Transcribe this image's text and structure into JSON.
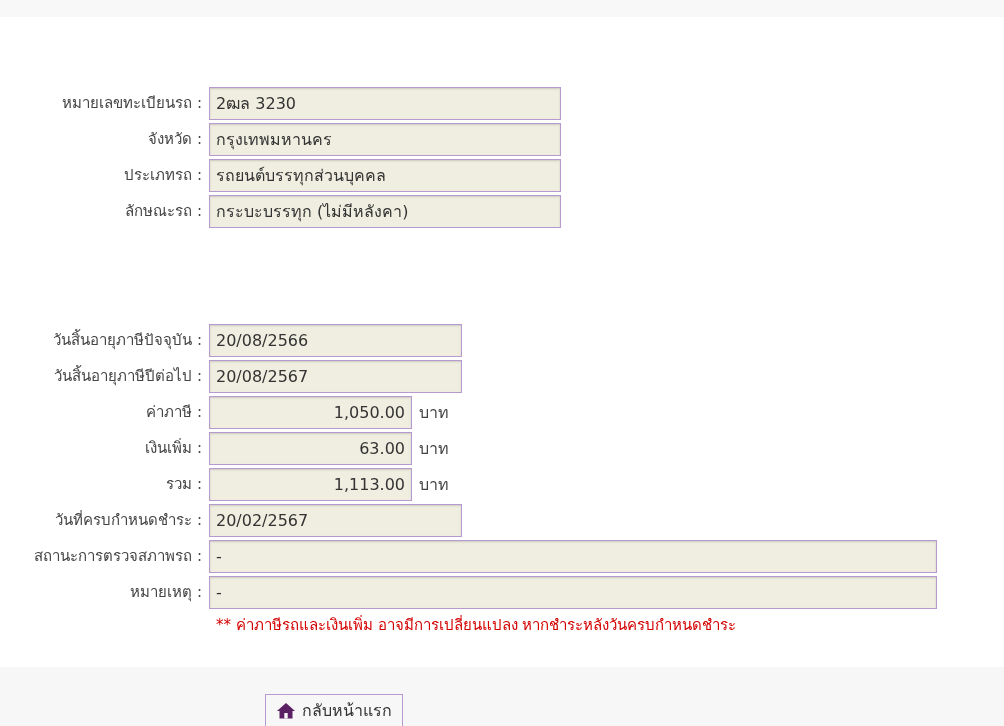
{
  "vehicle": [
    {
      "label": "หมายเลขทะเบียนรถ :",
      "value": "2ฒล 3230",
      "kind": "wide"
    },
    {
      "label": "จังหวัด :",
      "value": "กรุงเทพมหานคร",
      "kind": "wide"
    },
    {
      "label": "ประเภทรถ :",
      "value": "รถยนต์บรรทุกส่วนบุคคล",
      "kind": "wide"
    },
    {
      "label": "ลักษณะรถ :",
      "value": "กระบะบรรทุก (ไม่มีหลังคา)",
      "kind": "wide"
    }
  ],
  "tax": [
    {
      "label": "วันสิ้นอายุภาษีปัจจุบัน :",
      "value": "20/08/2566",
      "kind": "date"
    },
    {
      "label": "วันสิ้นอายุภาษีปีต่อไป :",
      "value": "20/08/2567",
      "kind": "date"
    },
    {
      "label": "ค่าภาษี :",
      "value": "1,050.00",
      "kind": "amount",
      "unit": "บาท"
    },
    {
      "label": "เงินเพิ่ม :",
      "value": "63.00",
      "kind": "amount",
      "unit": "บาท"
    },
    {
      "label": "รวม :",
      "value": "1,113.00",
      "kind": "amount",
      "unit": "บาท"
    },
    {
      "label": "วันที่ครบกำหนดชำระ :",
      "value": "20/02/2567",
      "kind": "date"
    },
    {
      "label": "สถานะการตรวจสภาพรถ :",
      "value": "-",
      "kind": "full"
    },
    {
      "label": "หมายเหตุ :",
      "value": "-",
      "kind": "full"
    }
  ],
  "note": "** ค่าภาษีรถและเงินเพิ่ม อาจมีการเปลี่ยนแปลง หากชำระหลังวันครบกำหนดชำระ",
  "home_button": "กลับหน้าแรก"
}
